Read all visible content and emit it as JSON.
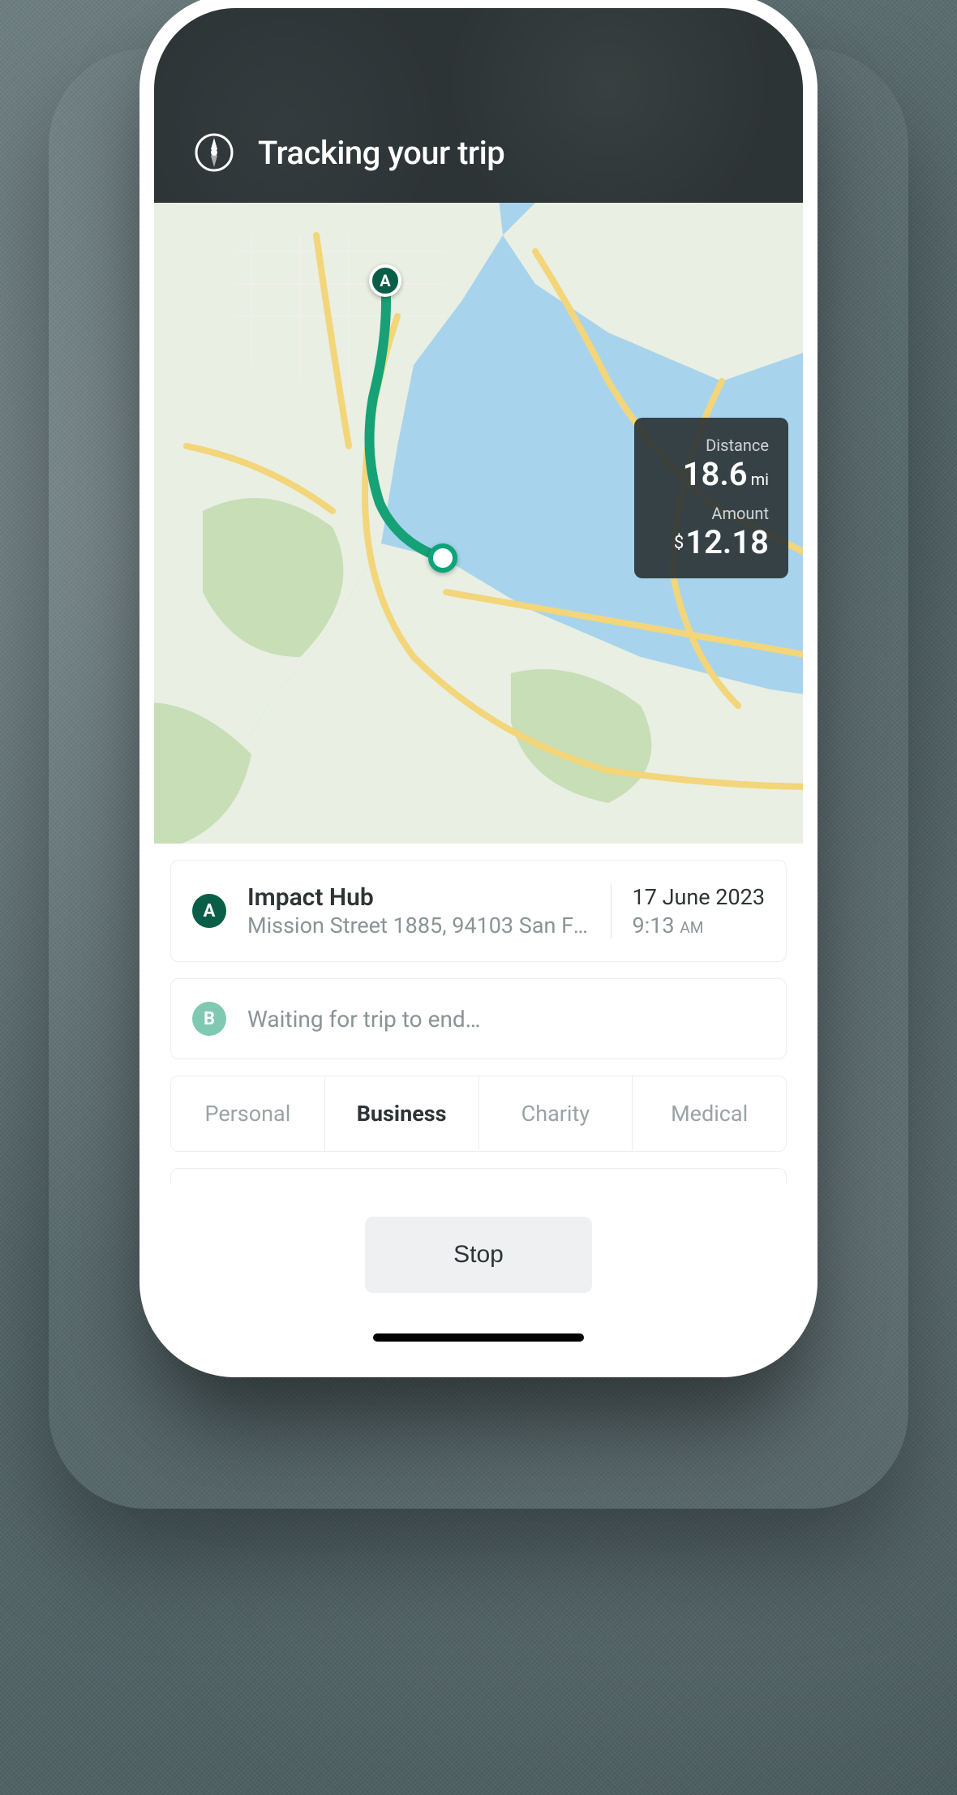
{
  "header": {
    "title": "Tracking your trip"
  },
  "overlay": {
    "distance_label": "Distance",
    "distance_value": "18.6",
    "distance_unit": "mi",
    "amount_label": "Amount",
    "amount_prefix": "$",
    "amount_value": "12.18"
  },
  "origin": {
    "marker": "A",
    "name": "Impact Hub",
    "address": "Mission Street 1885, 94103 San Fra…",
    "date": "17 June 2023",
    "time": "9:13",
    "ampm": "AM"
  },
  "destination": {
    "marker": "B",
    "waiting_text": "Waiting for trip to end…"
  },
  "categories": [
    "Personal",
    "Business",
    "Charity",
    "Medical"
  ],
  "active_category_index": 1,
  "stop_button": "Stop",
  "colors": {
    "route": "#17a176",
    "header_bg": "#2d3436",
    "water": "#a7d4ec"
  }
}
